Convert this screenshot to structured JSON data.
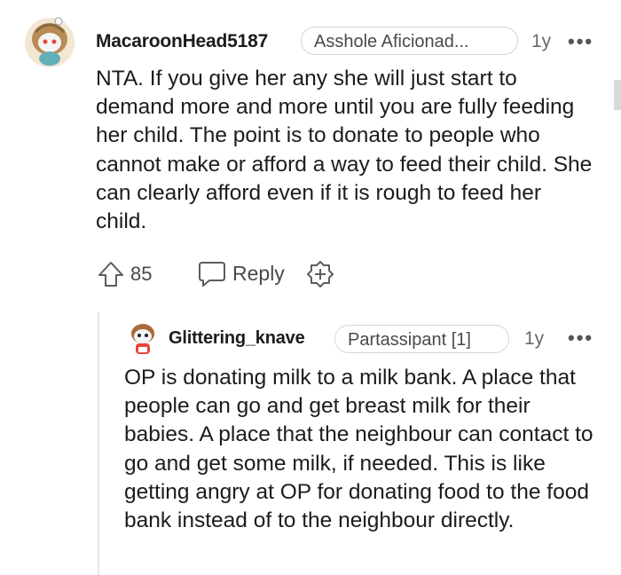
{
  "comment": {
    "username": "MacaroonHead5187",
    "flair": "Asshole Aficionad...",
    "age": "1y",
    "more": "•••",
    "body": "NTA. If you give her any she will just start to demand more and more until you are fully feeding her child. The point is to donate to people who cannot make or afford a way to feed their child. She can clearly afford even if it is rough to feed her child.",
    "upvotes": "85",
    "reply_label": "Reply",
    "avatar_icon": "snoo-avatar-icon"
  },
  "reply": {
    "username": "Glittering_knave",
    "flair": "Partassipant [1]",
    "age": "1y",
    "more": "•••",
    "body": "OP is donating milk to a milk bank. A place that people can go and get breast milk for their babies. A place that the neighbour can contact to go and get some milk, if needed. This is like getting angry at OP for donating food to the food bank instead of to the neighbour directly."
  },
  "colors": {
    "text": "#1c1c1c",
    "muted": "#6a6a6a",
    "border": "#d3d6da",
    "thread": "#e6e6e6"
  }
}
